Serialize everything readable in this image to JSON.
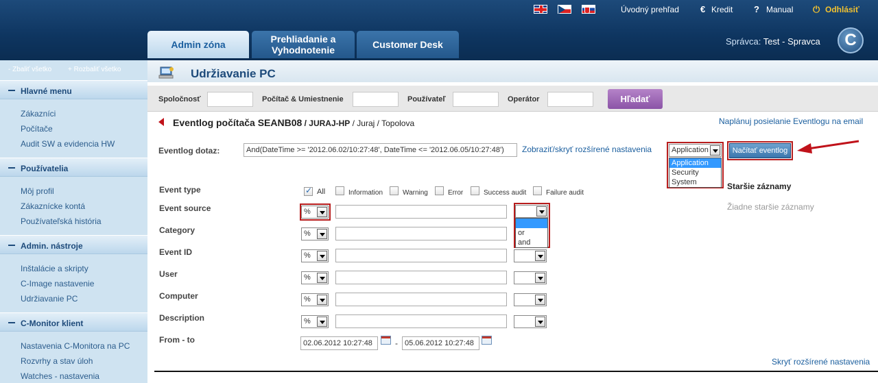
{
  "header": {
    "flags": [
      "english-flag",
      "czech-flag",
      "slovak-flag"
    ],
    "links": {
      "overview": "Úvodný prehľad",
      "credit": "Kredit",
      "manual": "Manual",
      "logout": "Odhlásiť"
    },
    "tabs": [
      {
        "label": "Admin zóna",
        "active": true
      },
      {
        "label": "Prehliadanie a Vyhodnotenie",
        "active": false
      },
      {
        "label": "Customer Desk",
        "active": false
      }
    ],
    "admin_prefix": "Správca:",
    "admin_name": "Test - Spravca",
    "logo_letter": "C"
  },
  "sidebar": {
    "collapse_all": "- Zbaliť všetko",
    "expand_all": "+ Rozbaliť všetko",
    "sections": [
      {
        "title": "Hlavné menu",
        "items": [
          "Zákazníci",
          "Počítače",
          "Audit SW a evidencia HW"
        ]
      },
      {
        "title": "Používatelia",
        "items": [
          "Môj profil",
          "Zákaznícke kontá",
          "Používateľská história"
        ]
      },
      {
        "title": "Admin. nástroje",
        "items": [
          "Inštalácie a skripty",
          "C-Image nastavenie",
          "Udržiavanie PC"
        ]
      },
      {
        "title": "C-Monitor klient",
        "items": [
          "Nastavenia C-Monitora na PC",
          "Rozvrhy a stav úloh",
          "Watches - nastavenia"
        ]
      }
    ]
  },
  "page": {
    "title": "Udržiavanie PC",
    "filters": {
      "company": "Spoločnosť",
      "computer": "Počítač & Umiestnenie",
      "user": "Používateľ",
      "operator": "Operátor",
      "search_button": "Hľadať"
    },
    "eventlog_title": "Eventlog počítača SEANB08",
    "eventlog_path_bold": " / JURAJ-HP",
    "eventlog_path": " / Juraj / Topolova",
    "plan_link": "Naplánuj posielanie Eventlogu na email",
    "query_label": "Eventlog dotaz:",
    "query_value": "And(DateTime >= '2012.06.02/10:27:48', DateTime <= '2012.06.05/10:27:48')",
    "toggle_link": "Zobraziť/skryť rozšírené nastavenia",
    "log_select": {
      "selected": "Application",
      "options": [
        "Application",
        "Security",
        "System"
      ]
    },
    "load_button": "Načítať eventlog",
    "older_title": "Staršie záznamy",
    "older_none": "Žiadne staršie záznamy",
    "event_type_label": "Event type",
    "event_types": [
      "All",
      "Information",
      "Warning",
      "Error",
      "Success audit",
      "Failure audit"
    ],
    "fields": [
      "Event source",
      "Category",
      "Event ID",
      "User",
      "Computer",
      "Description"
    ],
    "operator_value": "%",
    "logic_options": [
      "",
      "or",
      "and"
    ],
    "from_to_label": "From - to",
    "date_from": "02.06.2012 10:27:48",
    "date_sep": "-",
    "date_to": "05.06.2012 10:27:48",
    "hide_link": "Skryť rozšírené nastavenia"
  },
  "colors": {
    "header": "#0e3560",
    "accent_purple": "#8b54a7",
    "highlight_red": "#b71c1c",
    "selection_blue": "#3399ff"
  }
}
